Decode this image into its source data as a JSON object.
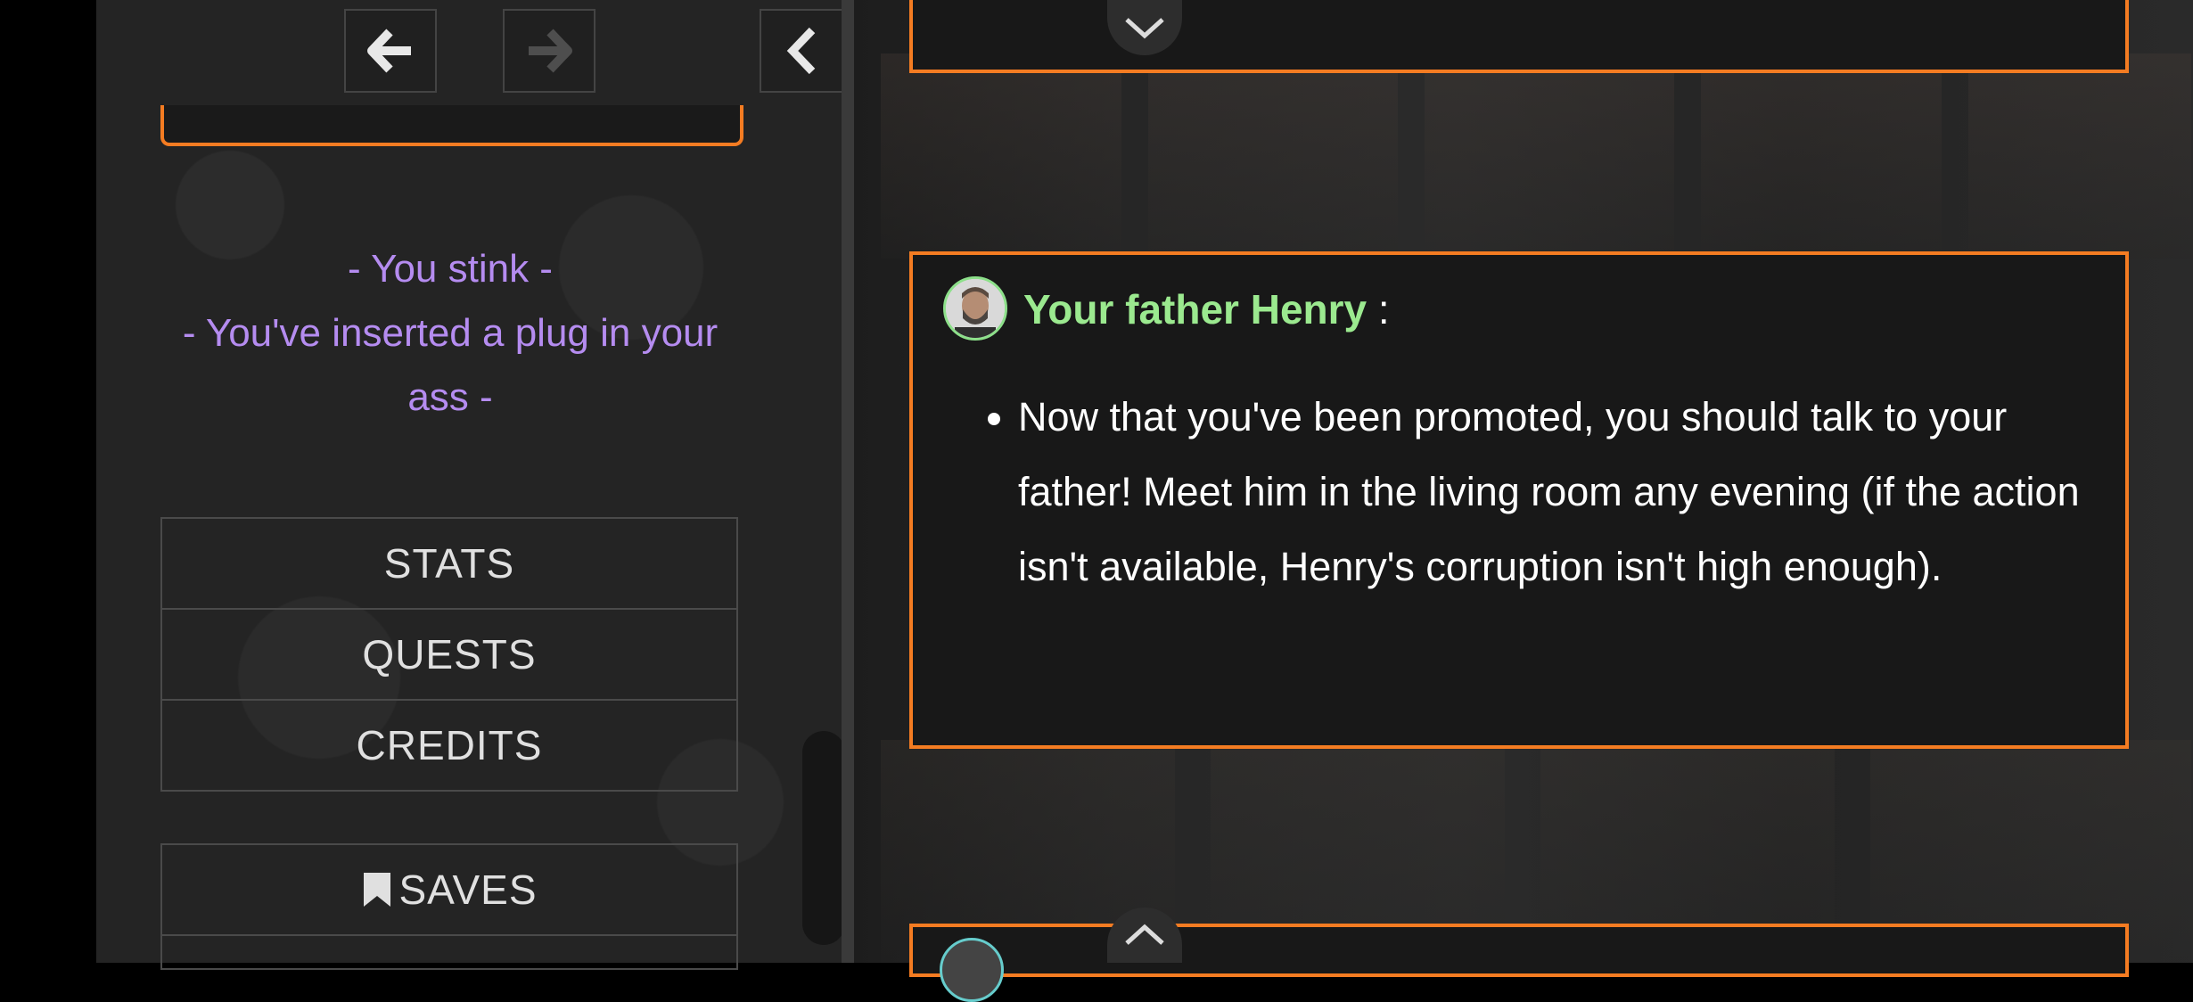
{
  "navigation": {
    "back_icon": "arrow-left-icon",
    "forward_icon": "arrow-right-icon",
    "collapse_icon": "chevron-left-icon"
  },
  "sidebar": {
    "status_effects": [
      "- You stink -",
      "- You've inserted a plug in your ass -"
    ],
    "menu": {
      "stats": "STATS",
      "quests": "QUESTS",
      "credits": "CREDITS",
      "saves": "SAVES",
      "saves_icon": "bookmark-icon"
    }
  },
  "messages": {
    "henry": {
      "speaker": "Your father Henry",
      "separator": " :",
      "items": [
        "Now that you've been promoted, you should talk to your father! Meet him in the living room any evening (if the action isn't available, Henry's corruption isn't high enough)."
      ]
    }
  },
  "colors": {
    "accent": "#f47c22",
    "status_text": "#b58cf0",
    "speaker_name": "#9be98f",
    "panel_bg": "#181818"
  }
}
